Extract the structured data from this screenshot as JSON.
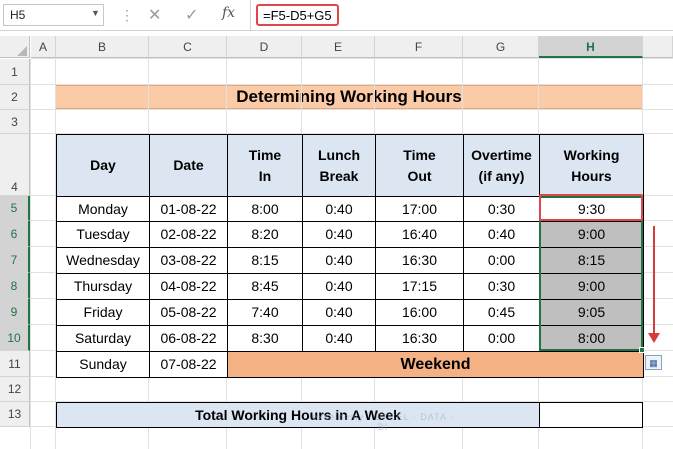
{
  "formula_bar": {
    "name_box": "H5",
    "fx_label": "fx",
    "formula": "=F5-D5+G5"
  },
  "columns": [
    "A",
    "B",
    "C",
    "D",
    "E",
    "F",
    "G",
    "H"
  ],
  "selected_column": "H",
  "rows": [
    "1",
    "2",
    "3",
    "4",
    "5",
    "6",
    "7",
    "8",
    "9",
    "10",
    "11",
    "12",
    "13"
  ],
  "selected_rows": [
    "5",
    "6",
    "7",
    "8",
    "9",
    "10"
  ],
  "sheet": {
    "title": "Determining Working Hours",
    "headers": [
      [
        "Day"
      ],
      [
        "Date"
      ],
      [
        "Time",
        "In"
      ],
      [
        "Lunch",
        "Break"
      ],
      [
        "Time",
        "Out"
      ],
      [
        "Overtime",
        "(if any)"
      ],
      [
        "Working",
        "Hours"
      ]
    ],
    "data_rows": [
      [
        "Monday",
        "01-08-22",
        "8:00",
        "0:40",
        "17:00",
        "0:30",
        "9:30"
      ],
      [
        "Tuesday",
        "02-08-22",
        "8:20",
        "0:40",
        "16:40",
        "0:40",
        "9:00"
      ],
      [
        "Wednesday",
        "03-08-22",
        "8:15",
        "0:40",
        "16:30",
        "0:00",
        "8:15"
      ],
      [
        "Thursday",
        "04-08-22",
        "8:45",
        "0:40",
        "17:15",
        "0:30",
        "9:00"
      ],
      [
        "Friday",
        "05-08-22",
        "7:40",
        "0:40",
        "16:00",
        "0:45",
        "9:05"
      ],
      [
        "Saturday",
        "06-08-22",
        "8:30",
        "0:40",
        "16:30",
        "0:00",
        "8:00"
      ]
    ],
    "sunday_row": {
      "day": "Sunday",
      "date": "07-08-22",
      "note": "Weekend"
    },
    "total_label": "Total Working Hours in A Week",
    "total_value": ""
  },
  "watermark": "exceldemy · EXCEL · DATA · BI",
  "colors": {
    "title_fill": "#fbcaa6",
    "header_fill": "#dce6f2",
    "selection_fill": "#bfbfbf",
    "weekend_fill": "#f4b184",
    "highlight_red": "#e0474c",
    "excel_green": "#217346"
  }
}
